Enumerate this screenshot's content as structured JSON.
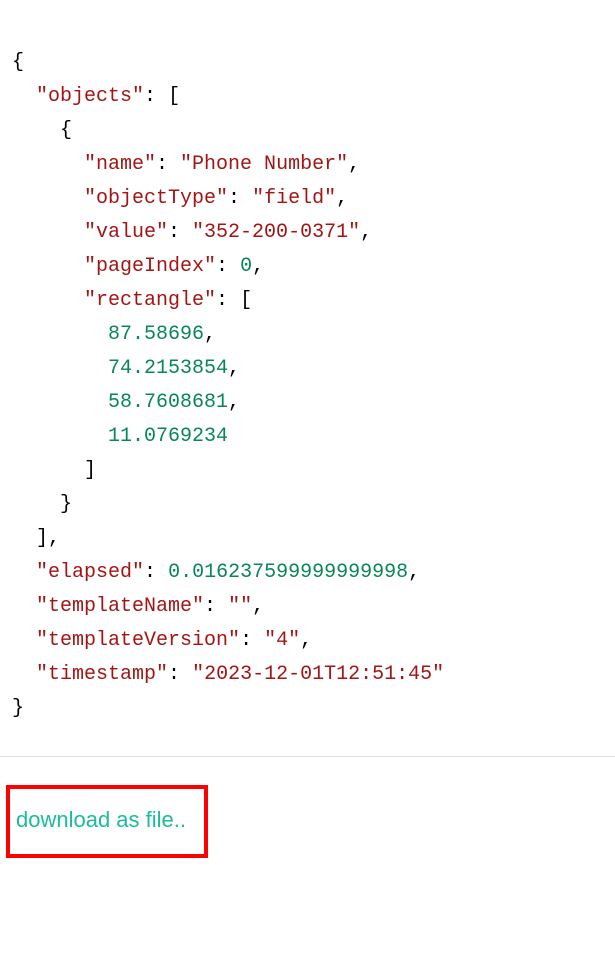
{
  "json": {
    "keys": {
      "objects": "\"objects\"",
      "name": "\"name\"",
      "objectType": "\"objectType\"",
      "value": "\"value\"",
      "pageIndex": "\"pageIndex\"",
      "rectangle": "\"rectangle\"",
      "elapsed": "\"elapsed\"",
      "templateName": "\"templateName\"",
      "templateVersion": "\"templateVersion\"",
      "timestamp": "\"timestamp\""
    },
    "values": {
      "name": "\"Phone Number\"",
      "objectType": "\"field\"",
      "value": "\"352-200-0371\"",
      "pageIndex": "0",
      "rect0": "87.58696",
      "rect1": "74.2153854",
      "rect2": "58.7608681",
      "rect3": "11.0769234",
      "elapsed": "0.016237599999999998",
      "templateName": "\"\"",
      "templateVersion": "\"4\"",
      "timestamp": "\"2023-12-01T12:51:45\""
    },
    "punct": {
      "openBrace": "{",
      "closeBrace": "}",
      "openBracket": "[",
      "closeBracket": "]",
      "colon": ": ",
      "comma": ","
    }
  },
  "link": {
    "download": "download as file.."
  }
}
